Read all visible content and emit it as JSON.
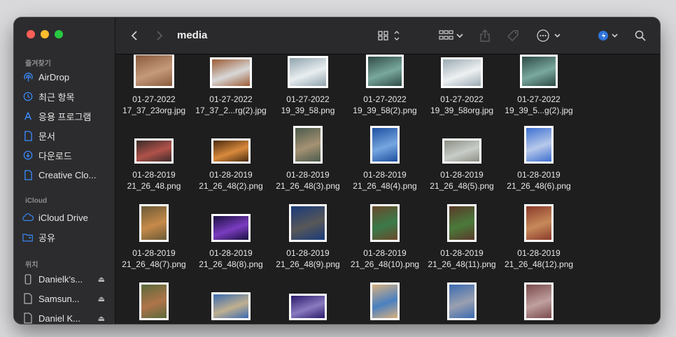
{
  "window": {
    "folder_title": "media"
  },
  "sidebar": {
    "favorites_header": "즐겨찾기",
    "favorites": [
      {
        "label": "AirDrop",
        "icon": "airdrop-icon"
      },
      {
        "label": "최근 항목",
        "icon": "clock-icon"
      },
      {
        "label": "응용 프로그램",
        "icon": "applications-icon"
      },
      {
        "label": "문서",
        "icon": "document-icon"
      },
      {
        "label": "다운로드",
        "icon": "download-icon"
      },
      {
        "label": "Creative Clo...",
        "icon": "file-icon"
      }
    ],
    "icloud_header": "iCloud",
    "icloud": [
      {
        "label": "iCloud Drive",
        "icon": "cloud-icon"
      },
      {
        "label": "공유",
        "icon": "shared-folder-icon"
      }
    ],
    "locations_header": "위치",
    "locations": [
      {
        "label": "Danielk's...",
        "icon": "phone-icon"
      },
      {
        "label": "Samsun...",
        "icon": "disk-icon"
      },
      {
        "label": "Daniel K...",
        "icon": "disk-icon"
      }
    ]
  },
  "files": [
    {
      "line1": "01-27-2022",
      "line2": "17_37_23org.jpg",
      "thumb": [
        "#8a5a3c",
        "#c49a7a"
      ]
    },
    {
      "line1": "01-27-2022",
      "line2": "17_37_2...rg(2).jpg",
      "thumb": [
        "#9c5b34",
        "#d8d8d8"
      ]
    },
    {
      "line1": "01-27-2022",
      "line2": "19_39_58.png",
      "thumb": [
        "#8fa3ad",
        "#e9eef0"
      ]
    },
    {
      "line1": "01-27-2022",
      "line2": "19_39_58(2).png",
      "thumb": [
        "#2f4b46",
        "#79a89d"
      ]
    },
    {
      "line1": "01-27-2022",
      "line2": "19_39_58org.jpg",
      "thumb": [
        "#9aaab3",
        "#eef1f2"
      ]
    },
    {
      "line1": "01-27-2022",
      "line2": "19_39_5...g(2).jpg",
      "thumb": [
        "#2c4944",
        "#7aa99f"
      ]
    },
    {
      "line1": "01-28-2019",
      "line2": "21_26_48.png",
      "thumb": [
        "#3a2a28",
        "#b0524a"
      ]
    },
    {
      "line1": "01-28-2019",
      "line2": "21_26_48(2).png",
      "thumb": [
        "#4a2a10",
        "#d98a3c"
      ]
    },
    {
      "line1": "01-28-2019",
      "line2": "21_26_48(3).png",
      "thumb": [
        "#4b5a4a",
        "#a59274"
      ]
    },
    {
      "line1": "01-28-2019",
      "line2": "21_26_48(4).png",
      "thumb": [
        "#1c4fa0",
        "#76a6e0"
      ]
    },
    {
      "line1": "01-28-2019",
      "line2": "21_26_48(5).png",
      "thumb": [
        "#8b8f84",
        "#c9cdc9"
      ]
    },
    {
      "line1": "01-28-2019",
      "line2": "21_26_48(6).png",
      "thumb": [
        "#3c6fd1",
        "#b7c9ea"
      ]
    },
    {
      "line1": "01-28-2019",
      "line2": "21_26_48(7).png",
      "thumb": [
        "#6b5a36",
        "#c78a4a"
      ]
    },
    {
      "line1": "01-28-2019",
      "line2": "21_26_48(8).png",
      "thumb": [
        "#1a1040",
        "#7a3cc0"
      ]
    },
    {
      "line1": "01-28-2019",
      "line2": "21_26_48(9).png",
      "thumb": [
        "#1a3a7a",
        "#585858"
      ]
    },
    {
      "line1": "01-28-2019",
      "line2": "21_26_48(10).png",
      "thumb": [
        "#6a4a2a",
        "#3a7a4a"
      ]
    },
    {
      "line1": "01-28-2019",
      "line2": "21_26_48(11).png",
      "thumb": [
        "#5a3a2a",
        "#4a7a3a"
      ]
    },
    {
      "line1": "01-28-2019",
      "line2": "21_26_48(12).png",
      "thumb": [
        "#8a3a2a",
        "#c78a5a"
      ]
    },
    {
      "line1": "",
      "line2": "",
      "thumb": [
        "#5a6a3a",
        "#b0744a"
      ]
    },
    {
      "line1": "",
      "line2": "",
      "thumb": [
        "#3a6ab0",
        "#c0b090"
      ]
    },
    {
      "line1": "",
      "line2": "",
      "thumb": [
        "#2a1a6a",
        "#8a7ac0"
      ]
    },
    {
      "line1": "",
      "line2": "",
      "thumb": [
        "#d8b080",
        "#4a80c0"
      ]
    },
    {
      "line1": "",
      "line2": "",
      "thumb": [
        "#3a6ab0",
        "#9aa0b0"
      ]
    },
    {
      "line1": "",
      "line2": "",
      "thumb": [
        "#7a4a4a",
        "#c0a0a0"
      ]
    }
  ]
}
